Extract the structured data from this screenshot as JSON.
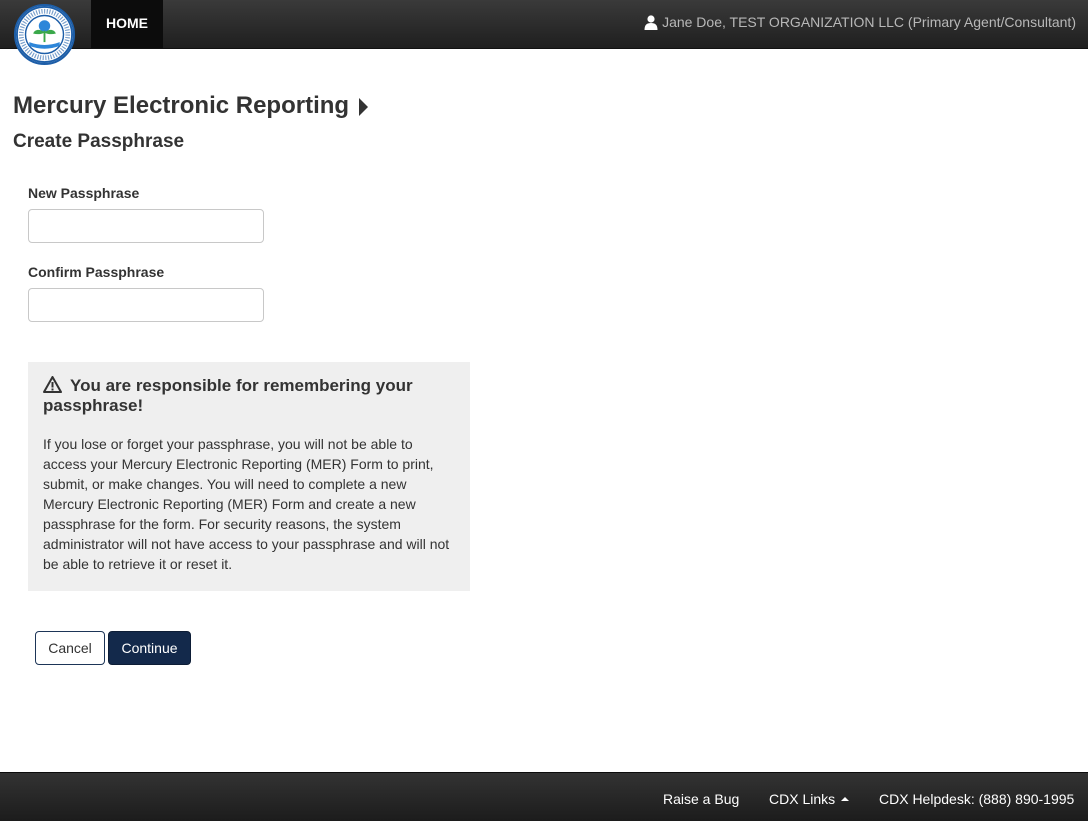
{
  "nav": {
    "home_label": "HOME",
    "user_text": "Jane Doe, TEST ORGANIZATION LLC (Primary Agent/Consultant)"
  },
  "header": {
    "app_title": "Mercury Electronic Reporting",
    "page_title": "Create Passphrase"
  },
  "form": {
    "new_passphrase_label": "New Passphrase",
    "new_passphrase_value": "",
    "confirm_passphrase_label": "Confirm Passphrase",
    "confirm_passphrase_value": ""
  },
  "warning": {
    "title": "You are responsible for remembering your passphrase!",
    "body": "If you lose or forget your passphrase, you will not be able to access your Mercury Electronic Reporting (MER) Form to print, submit, or make changes. You will need to complete a new Mercury Electronic Reporting (MER) Form and create a new passphrase for the form. For security reasons, the system administrator will not have access to your passphrase and will not be able to retrieve it or reset it."
  },
  "actions": {
    "cancel_label": "Cancel",
    "continue_label": "Continue"
  },
  "footer": {
    "raise_bug_label": "Raise a Bug",
    "cdx_links_label": "CDX Links",
    "helpdesk_label": "CDX Helpdesk: (888) 890-1995"
  },
  "colors": {
    "navbar": "#2b2b2b",
    "primary_button": "#13294b",
    "warning_background": "#efefef"
  },
  "icons": {
    "logo": "epa-seal-logo",
    "user": "user-icon",
    "warning": "warning-triangle-icon",
    "title_caret": "caret-right-icon",
    "cdx_links_caret": "caret-up-icon"
  }
}
